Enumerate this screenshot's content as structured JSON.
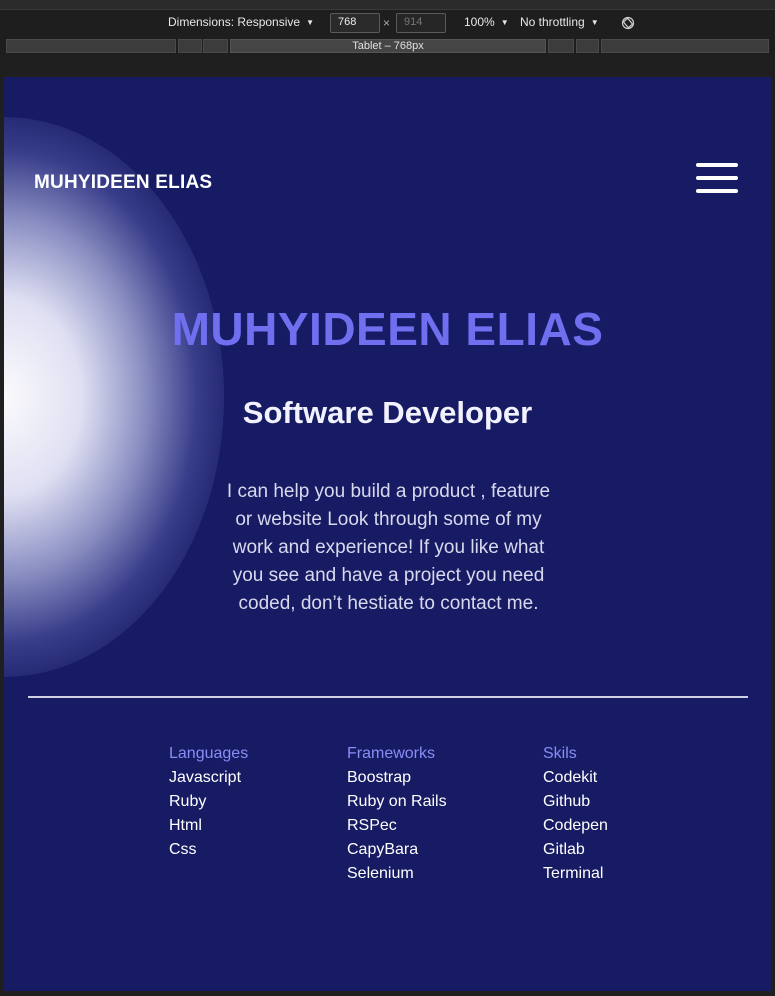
{
  "devtools": {
    "dimensions_label": "Dimensions: Responsive",
    "width_value": "768",
    "height_placeholder": "914",
    "times": "×",
    "zoom": "100%",
    "throttling": "No throttling",
    "media_query_label": "Tablet – 768px"
  },
  "header": {
    "logo": "MUHYIDEEN ELIAS"
  },
  "hero": {
    "title": "MUHYIDEEN ELIAS",
    "subtitle": "Software Developer",
    "description": "I can help you build a product , feature or website Look through some of my work and experience! If you like what you see and have a project you need coded, don’t hestiate to contact me."
  },
  "footer": {
    "columns": [
      {
        "heading": "Languages",
        "items": [
          "Javascript",
          "Ruby",
          "Html",
          "Css"
        ]
      },
      {
        "heading": "Frameworks",
        "items": [
          "Boostrap",
          "Ruby on Rails",
          "RSPec",
          "CapyBara",
          "Selenium"
        ]
      },
      {
        "heading": "Skils",
        "items": [
          "Codekit",
          "Github",
          "Codepen",
          "Gitlab",
          "Terminal"
        ]
      }
    ]
  },
  "colors": {
    "page_background": "#171b63",
    "accent": "#6f6ff0",
    "column_heading": "#8b8cf5"
  },
  "icons": [
    "caret-down-icon",
    "rotate-icon",
    "hamburger-menu-icon"
  ]
}
